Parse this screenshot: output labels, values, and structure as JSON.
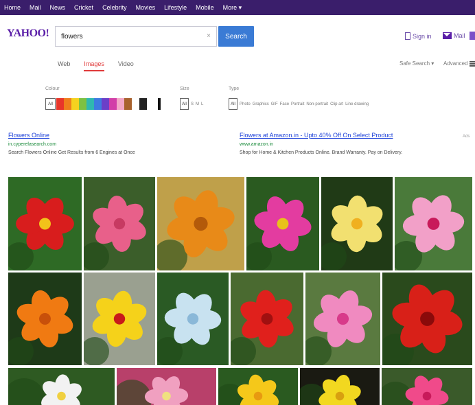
{
  "nav": [
    "Home",
    "Mail",
    "News",
    "Cricket",
    "Celebrity",
    "Movies",
    "Lifestyle",
    "Mobile",
    "More ▾"
  ],
  "logo": "YAHOO!",
  "search": {
    "value": "flowers",
    "clear": "×",
    "button": "Search"
  },
  "account": {
    "signin": "Sign in",
    "mail": "Mail"
  },
  "tabs": [
    "Web",
    "Images",
    "Video"
  ],
  "safesearch": "Safe Search ▾",
  "advanced": "Advanced",
  "filters": {
    "colour_label": "Colour",
    "size_label": "Size",
    "type_label": "Type",
    "all": "All",
    "swatch_colors": [
      "#e8362a",
      "#ef7e1c",
      "#f5d21f",
      "#7dc142",
      "#2fb8b0",
      "#3d7be0",
      "#6b3fc8",
      "#d23fa8",
      "#f3a8c8",
      "#a8622e",
      "#ffffff",
      "#222222",
      "#888888"
    ],
    "sizes": [
      "All",
      "S",
      "M",
      "L"
    ],
    "types": [
      "All",
      "Photo",
      "Graphics",
      "GIF",
      "Face",
      "Portrait",
      "Non-portrait",
      "Clip art",
      "Line drawing"
    ]
  },
  "ads": [
    {
      "title": "Flowers Online",
      "url": "in.cyperelasearch.com",
      "desc": "Search Flowers Online Get Results from 6 Engines at Once"
    },
    {
      "title": "Flowers at Amazon.in - Upto 40% Off On Select Product",
      "url": "www.amazon.in",
      "desc": "Shop for Home & Kitchen Products Online. Brand Warranty. Pay on Delivery."
    }
  ],
  "ad_corner": "Ads",
  "images": [
    {
      "name": "red-gerbera",
      "bg": "#2e6a25",
      "petal": "#d81d1d",
      "center": "#f2c21a"
    },
    {
      "name": "pink-rose",
      "bg": "#3b5e2a",
      "petal": "#e8608a",
      "center": "#c73a62"
    },
    {
      "name": "orange-marigold",
      "bg": "#bfa04a",
      "petal": "#e88a18",
      "center": "#b35a0a"
    },
    {
      "name": "pink-zinnia",
      "bg": "#2a5a20",
      "petal": "#e33ca0",
      "center": "#e8c21a"
    },
    {
      "name": "yellow-frangipani",
      "bg": "#203a16",
      "petal": "#f2e070",
      "center": "#f0b020"
    },
    {
      "name": "pink-hibiscus",
      "bg": "#4a7a3a",
      "petal": "#f2a0c8",
      "center": "#c81a5a"
    },
    {
      "name": "orange-cosmos",
      "bg": "#1e3a18",
      "petal": "#f07a12",
      "center": "#c8500a"
    },
    {
      "name": "yellow-hibiscus",
      "bg": "#9aa090",
      "petal": "#f5d21a",
      "center": "#c81a1a"
    },
    {
      "name": "blue-plumbago",
      "bg": "#2a5a24",
      "petal": "#c8e2f0",
      "center": "#8ab8d8"
    },
    {
      "name": "red-lily",
      "bg": "#4a6a30",
      "petal": "#e0201c",
      "center": "#a01010"
    },
    {
      "name": "pink-lily",
      "bg": "#5a7a40",
      "petal": "#f08ac0",
      "center": "#d83a8a"
    },
    {
      "name": "red-hibiscus",
      "bg": "#2a4a1c",
      "petal": "#d82018",
      "center": "#8a0a0a"
    },
    {
      "name": "white-flower",
      "bg": "#2e5a22",
      "petal": "#f2f2f2",
      "center": "#f0d040"
    },
    {
      "name": "pink-daisies",
      "bg": "#b8406a",
      "petal": "#f0a0c0",
      "center": "#f0e080"
    },
    {
      "name": "yellow-tulip",
      "bg": "#2a5a20",
      "petal": "#f5c81a",
      "center": "#e89a10"
    },
    {
      "name": "yellow-dandelion",
      "bg": "#1a1a12",
      "petal": "#f2d820",
      "center": "#d8a010"
    },
    {
      "name": "pink-flower",
      "bg": "#3a5a2a",
      "petal": "#f04a8a",
      "center": "#c81a5a"
    }
  ]
}
